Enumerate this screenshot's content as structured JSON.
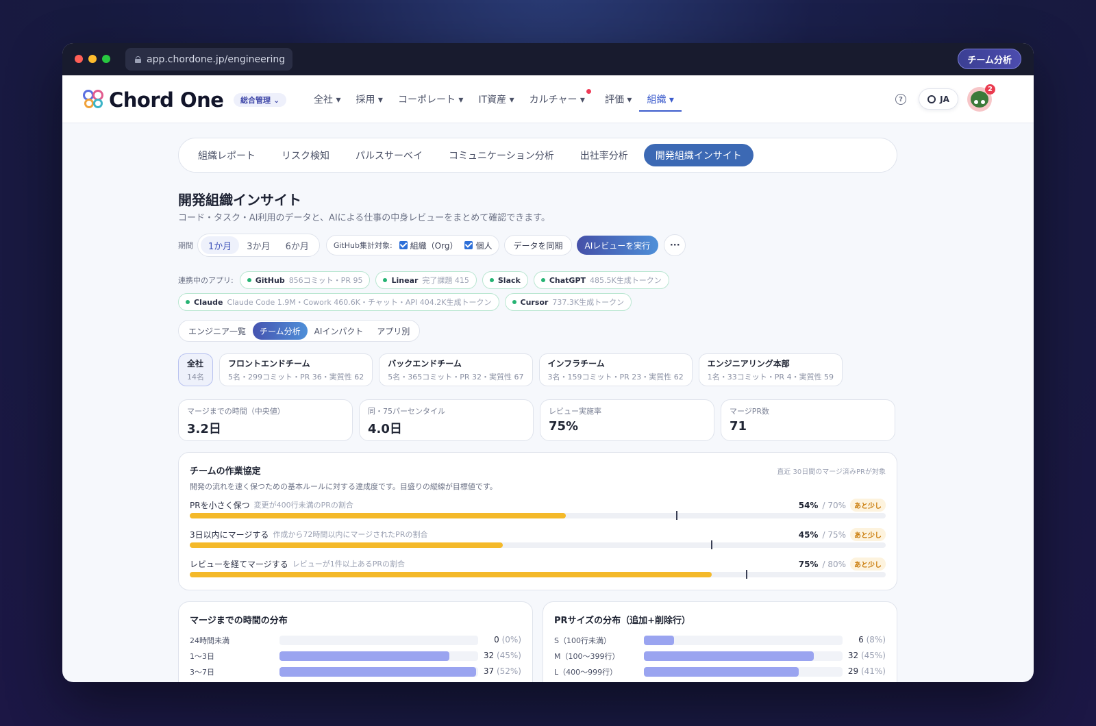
{
  "window": {
    "url": "app.chordone.jp/engineering",
    "title_pill": "チーム分析"
  },
  "header": {
    "logo_text": "Chord One",
    "scope_label": "総合管理",
    "nav": [
      {
        "label": "全社 ▾"
      },
      {
        "label": "採用 ▾"
      },
      {
        "label": "コーポレート ▾"
      },
      {
        "label": "IT資産 ▾"
      },
      {
        "label": "カルチャー ▾"
      },
      {
        "label": "評価 ▾"
      },
      {
        "label": "組織 ▾"
      }
    ],
    "help_label": "?",
    "lang_label": "JA",
    "notification_count": "2",
    "colors": {
      "accent": "#3b5bcc",
      "notification": "#ea3b4f"
    }
  },
  "subtabs": [
    {
      "label": "組織レポート"
    },
    {
      "label": "リスク検知"
    },
    {
      "label": "パルスサーベイ"
    },
    {
      "label": "コミュニケーション分析"
    },
    {
      "label": "出社率分析"
    },
    {
      "label": "開発組織インサイト"
    }
  ],
  "page": {
    "title": "開発組織インサイト",
    "description": "コード・タスク・AI利用のデータと、AIによる仕事の中身レビューをまとめて確認できます。"
  },
  "controls": {
    "period_label": "期間",
    "periods": [
      {
        "label": "1か月"
      },
      {
        "label": "3か月"
      },
      {
        "label": "6か月"
      }
    ],
    "github_label": "GitHub集計対象:",
    "github_org": "組織（Org）",
    "github_personal": "個人",
    "sync_label": "データを同期",
    "ai_review_label": "AIレビューを実行",
    "more_label": "···"
  },
  "apps": {
    "label": "連携中のアプリ:",
    "items": [
      {
        "name": "GitHub",
        "meta": "856コミット・PR 95"
      },
      {
        "name": "Linear",
        "meta": "完了課題 415"
      },
      {
        "name": "Slack",
        "meta": ""
      },
      {
        "name": "ChatGPT",
        "meta": "485.5K生成トークン"
      },
      {
        "name": "Claude",
        "meta": "Claude Code 1.9M・Cowork 460.6K・チャット・API 404.2K生成トークン"
      },
      {
        "name": "Cursor",
        "meta": "737.3K生成トークン"
      }
    ]
  },
  "view_tabs": [
    {
      "label": "エンジニア一覧"
    },
    {
      "label": "チーム分析"
    },
    {
      "label": "AIインパクト"
    },
    {
      "label": "アプリ別"
    }
  ],
  "teams": [
    {
      "name": "全社",
      "meta": "14名"
    },
    {
      "name": "フロントエンドチーム",
      "meta": "5名・299コミット・PR 36・実質性 62"
    },
    {
      "name": "バックエンドチーム",
      "meta": "5名・365コミット・PR 32・実質性 67"
    },
    {
      "name": "インフラチーム",
      "meta": "3名・159コミット・PR 23・実質性 62"
    },
    {
      "name": "エンジニアリング本部",
      "meta": "1名・33コミット・PR 4・実質性 59"
    }
  ],
  "kpis": [
    {
      "label": "マージまでの時間（中央値）",
      "value": "3.2日"
    },
    {
      "label": "同・75パーセンタイル",
      "value": "4.0日"
    },
    {
      "label": "レビュー実施率",
      "value": "75%"
    },
    {
      "label": "マージPR数",
      "value": "71"
    }
  ],
  "agreement": {
    "title": "チームの作業協定",
    "note": "直近 30日間のマージ済みPRが対象",
    "description": "開発の流れを速く保つための基本ルールに対する達成度です。目盛りの縦線が目標値です。",
    "goals": [
      {
        "name": "PRを小さく保つ",
        "sub": "変更が400行未満のPRの割合",
        "value": 54,
        "target": 70,
        "value_label": "54%",
        "target_label": "/ 70%",
        "tag": "あと少し"
      },
      {
        "name": "3日以内にマージする",
        "sub": "作成から72時間以内にマージされたPRの割合",
        "value": 45,
        "target": 75,
        "value_label": "45%",
        "target_label": "/ 75%",
        "tag": "あと少し"
      },
      {
        "name": "レビューを経てマージする",
        "sub": "レビューが1件以上あるPRの割合",
        "value": 75,
        "target": 80,
        "value_label": "75%",
        "target_label": "/ 80%",
        "tag": "あと少し"
      }
    ]
  },
  "merge_time_dist": {
    "title": "マージまでの時間の分布",
    "rows": [
      {
        "label": "24時間未満",
        "count": "0",
        "pct": "(0%)",
        "value": 0
      },
      {
        "label": "1〜3日",
        "count": "32",
        "pct": "(45%)",
        "value": 45
      },
      {
        "label": "3〜7日",
        "count": "37",
        "pct": "(52%)",
        "value": 52
      }
    ]
  },
  "pr_size_dist": {
    "title": "PRサイズの分布（追加+削除行）",
    "rows": [
      {
        "label": "S（100行未満）",
        "count": "6",
        "pct": "(8%)",
        "value": 8
      },
      {
        "label": "M（100〜399行）",
        "count": "32",
        "pct": "(45%)",
        "value": 45
      },
      {
        "label": "L（400〜999行）",
        "count": "29",
        "pct": "(41%)",
        "value": 41
      }
    ]
  }
}
